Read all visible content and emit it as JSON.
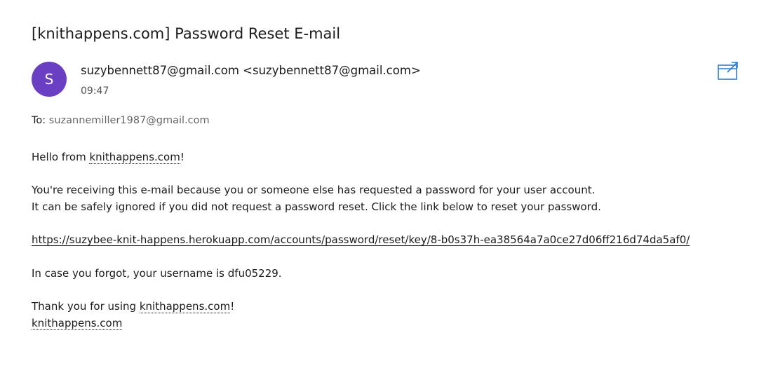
{
  "email": {
    "subject": "[knithappens.com] Password Reset E-mail",
    "sender": {
      "initial": "S",
      "display": "suzybennett87@gmail.com <suzybennett87@gmail.com>",
      "time": "09:47",
      "avatar_color": "#6b3fc3"
    },
    "to": {
      "label": "To:",
      "address": "suzannemiller1987@gmail.com"
    },
    "popout_icon": "open-in-new-window-icon",
    "body": {
      "greeting_prefix": "Hello from ",
      "greeting_link": "knithappens.com",
      "greeting_suffix": "!",
      "para1_line1": "You're receiving this e-mail because you or someone else has requested a password for your user account.",
      "para1_line2": "It can be safely ignored if you did not request a password reset. Click the link below to reset your password.",
      "reset_url": "https://suzybee-knit-happens.herokuapp.com/accounts/password/reset/key/8-b0s37h-ea38564a7a0ce27d06ff216d74da5af0/",
      "username_line": "In case you forgot, your username is dfu05229.",
      "thanks_prefix": "Thank you for using ",
      "thanks_link": "knithappens.com",
      "thanks_suffix": "!",
      "signature_link": "knithappens.com"
    }
  }
}
